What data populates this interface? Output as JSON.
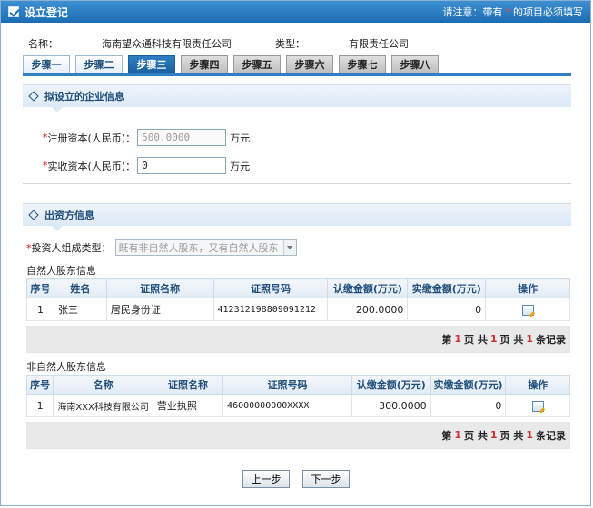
{
  "window": {
    "title": "设立登记",
    "notice_prefix": "请注意：带有",
    "notice_star": "*",
    "notice_suffix": "的项目必须填写"
  },
  "company": {
    "name_label": "名称：",
    "name": "海南望众通科技有限责任公司",
    "type_label": "类型：",
    "type": "有限责任公司"
  },
  "tabs": [
    {
      "label": "步骤一",
      "state": "done"
    },
    {
      "label": "步骤二",
      "state": "done"
    },
    {
      "label": "步骤三",
      "state": "active"
    },
    {
      "label": "步骤四",
      "state": "todo"
    },
    {
      "label": "步骤五",
      "state": "todo"
    },
    {
      "label": "步骤六",
      "state": "todo"
    },
    {
      "label": "步骤七",
      "state": "todo"
    },
    {
      "label": "步骤八",
      "state": "todo"
    }
  ],
  "section1": {
    "title": "拟设立的企业信息",
    "registered_capital": {
      "required": "*",
      "label": "注册资本(人民币)：",
      "value": "500.0000",
      "unit": "万元"
    },
    "paidin_capital": {
      "required": "*",
      "label": "实收资本(人民币)：",
      "value": "0",
      "unit": "万元"
    }
  },
  "section2": {
    "title": "出资方信息",
    "investor_type": {
      "required": "*",
      "label": "投资人组成类型：",
      "value": "既有非自然人股东，又有自然人股东"
    },
    "natural": {
      "caption": "自然人股东信息",
      "headers": [
        "序号",
        "姓名",
        "证照名称",
        "证照号码",
        "认缴金额(万元)",
        "实缴金额(万元)",
        "操作"
      ],
      "rows": [
        {
          "no": "1",
          "name": "张三",
          "cert": "居民身份证",
          "cert_no": "412312198809091212",
          "subscribed": "200.0000",
          "paid": "0"
        }
      ],
      "pager": {
        "t1": "第",
        "page": "1",
        "t2": "页 共",
        "pages": "1",
        "t3": "页 共",
        "count": "1",
        "t4": "条记录"
      }
    },
    "nonnatural": {
      "caption": "非自然人股东信息",
      "headers": [
        "序号",
        "名称",
        "证照名称",
        "证照号码",
        "认缴金额(万元)",
        "实缴金额(万元)",
        "操作"
      ],
      "rows": [
        {
          "no": "1",
          "name": "海南XXX科技有限公司",
          "cert": "营业执照",
          "cert_no": "46000000000XXXX",
          "subscribed": "300.0000",
          "paid": "0"
        }
      ],
      "pager": {
        "t1": "第",
        "page": "1",
        "t2": "页 共",
        "pages": "1",
        "t3": "页 共",
        "count": "1",
        "t4": "条记录"
      }
    }
  },
  "footer": {
    "prev": "上一步",
    "next": "下一步"
  }
}
